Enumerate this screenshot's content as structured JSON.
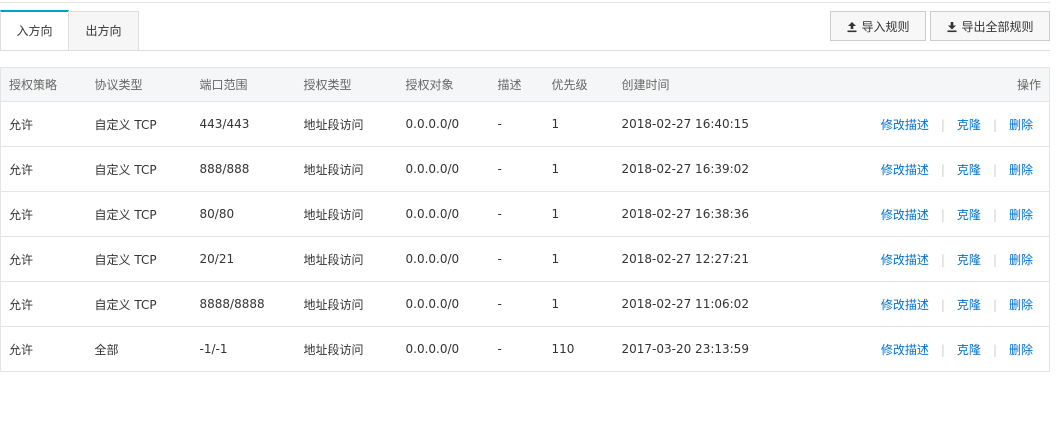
{
  "tabs": [
    {
      "label": "入方向",
      "active": true
    },
    {
      "label": "出方向",
      "active": false
    }
  ],
  "toolbar": {
    "import_label": "导入规则",
    "export_label": "导出全部规则"
  },
  "table": {
    "columns": [
      "授权策略",
      "协议类型",
      "端口范围",
      "授权类型",
      "授权对象",
      "描述",
      "优先级",
      "创建时间",
      "操作"
    ],
    "rows": [
      {
        "policy": "允许",
        "protocol": "自定义 TCP",
        "ports": "443/443",
        "auth_type": "地址段访问",
        "object": "0.0.0.0/0",
        "desc": "-",
        "priority": "1",
        "created": "2018-02-27 16:40:15"
      },
      {
        "policy": "允许",
        "protocol": "自定义 TCP",
        "ports": "888/888",
        "auth_type": "地址段访问",
        "object": "0.0.0.0/0",
        "desc": "-",
        "priority": "1",
        "created": "2018-02-27 16:39:02"
      },
      {
        "policy": "允许",
        "protocol": "自定义 TCP",
        "ports": "80/80",
        "auth_type": "地址段访问",
        "object": "0.0.0.0/0",
        "desc": "-",
        "priority": "1",
        "created": "2018-02-27 16:38:36"
      },
      {
        "policy": "允许",
        "protocol": "自定义 TCP",
        "ports": "20/21",
        "auth_type": "地址段访问",
        "object": "0.0.0.0/0",
        "desc": "-",
        "priority": "1",
        "created": "2018-02-27 12:27:21"
      },
      {
        "policy": "允许",
        "protocol": "自定义 TCP",
        "ports": "8888/8888",
        "auth_type": "地址段访问",
        "object": "0.0.0.0/0",
        "desc": "-",
        "priority": "1",
        "created": "2018-02-27 11:06:02"
      },
      {
        "policy": "允许",
        "protocol": "全部",
        "ports": "-1/-1",
        "auth_type": "地址段访问",
        "object": "0.0.0.0/0",
        "desc": "-",
        "priority": "110",
        "created": "2017-03-20 23:13:59"
      }
    ],
    "actions": {
      "edit": "修改描述",
      "clone": "克隆",
      "delete": "删除",
      "separator": "|"
    }
  },
  "colors": {
    "accent": "#00a2ca",
    "link": "#0070cc",
    "header_bg": "#f5f6f7",
    "border": "#e5e5e5"
  },
  "icons": {
    "import": "upload-icon",
    "export": "download-icon"
  }
}
